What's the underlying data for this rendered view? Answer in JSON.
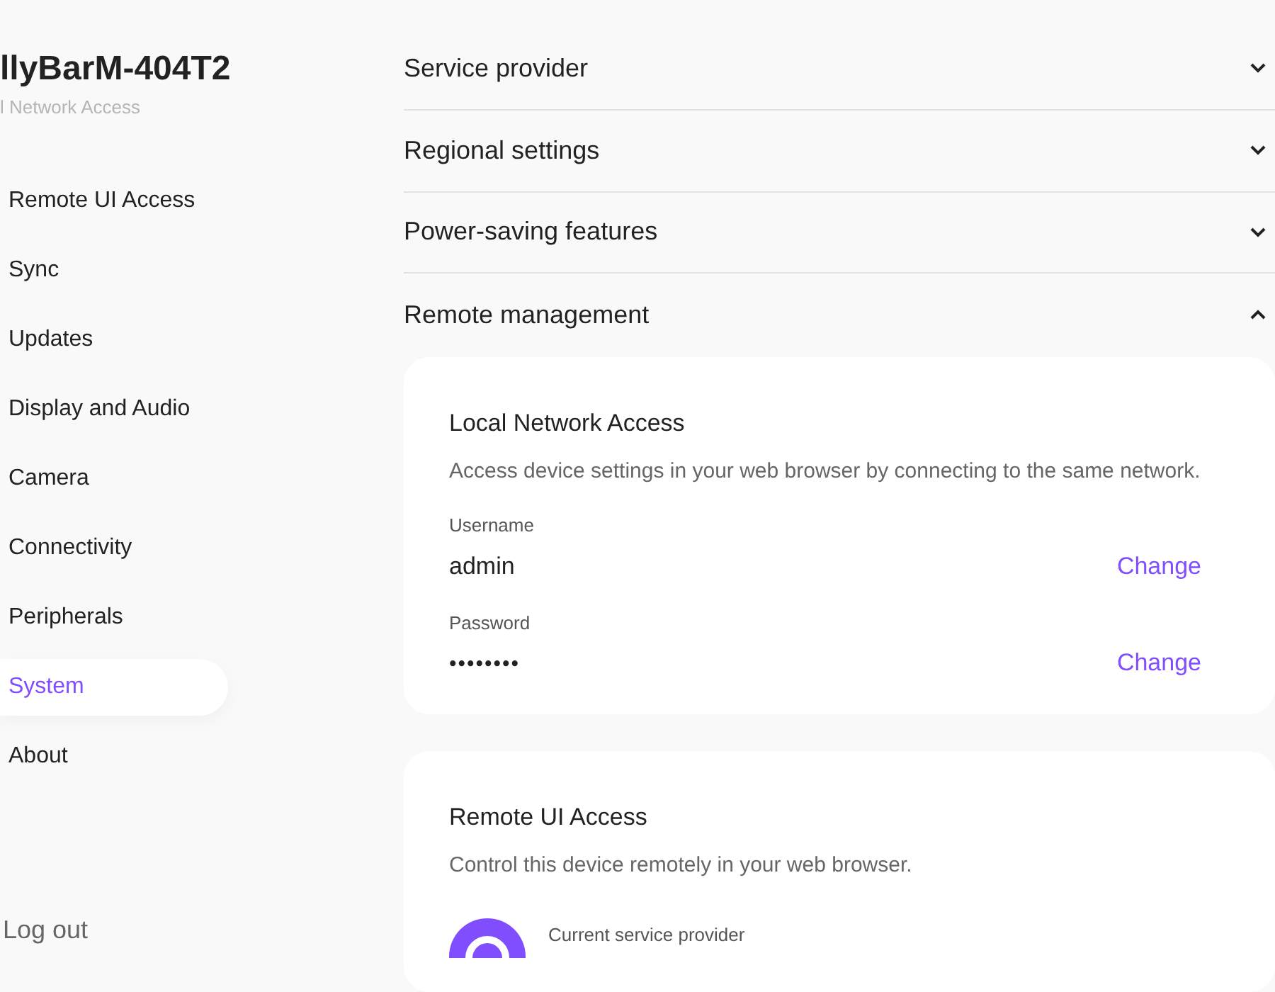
{
  "device": {
    "name": "llyBarM-404T2",
    "subtitle": "l Network Access"
  },
  "nav": [
    {
      "label": "Remote UI Access",
      "selected": false
    },
    {
      "label": "Sync",
      "selected": false
    },
    {
      "label": "Updates",
      "selected": false
    },
    {
      "label": "Display and Audio",
      "selected": false
    },
    {
      "label": "Camera",
      "selected": false
    },
    {
      "label": "Connectivity",
      "selected": false
    },
    {
      "label": "Peripherals",
      "selected": false
    },
    {
      "label": "System",
      "selected": true
    },
    {
      "label": "About",
      "selected": false
    }
  ],
  "logout": "Log out",
  "sections": [
    {
      "title": "Service provider",
      "expanded": false
    },
    {
      "title": "Regional settings",
      "expanded": false
    },
    {
      "title": "Power-saving features",
      "expanded": false
    },
    {
      "title": "Remote management",
      "expanded": true
    }
  ],
  "cards": [
    {
      "title": "Local Network Access",
      "description": "Access device settings in your web browser by connecting to the same network.",
      "fields": [
        {
          "kind": "text",
          "label": "Username",
          "value": "admin",
          "action": "Change"
        },
        {
          "kind": "password",
          "label": "Password",
          "value": "••••••••",
          "action": "Change"
        }
      ]
    },
    {
      "title": "Remote UI Access",
      "description": "Control this device remotely in your web browser.",
      "provider_label": "Current service provider"
    }
  ]
}
